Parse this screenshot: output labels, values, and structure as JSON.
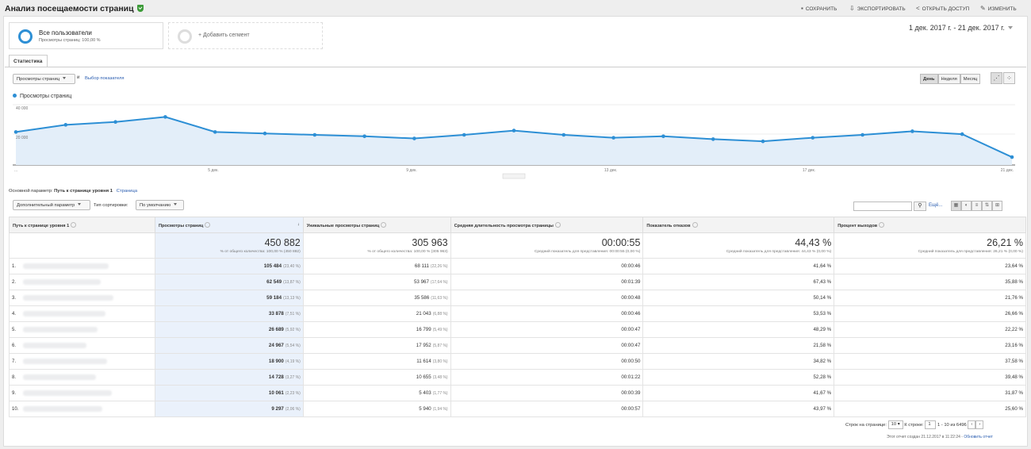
{
  "header": {
    "title": "Анализ посещаемости страниц",
    "actions": [
      "СОХРАНИТЬ",
      "ЭКСПОРТИРОВАТЬ",
      "ОТКРЫТЬ ДОСТУП",
      "ИЗМЕНИТЬ"
    ]
  },
  "segments": {
    "active_title": "Все пользователи",
    "active_sub": "Просмотры страниц: 100,00 %",
    "add_label": "+ Добавить сегмент"
  },
  "date_range": "1 дек. 2017 г. - 21 дек. 2017 г.",
  "tab": "Статистика",
  "metric_select": "Просмотры страниц",
  "and_label": "и",
  "choose_metric": "Выбор показателя",
  "granularity": [
    "День",
    "Неделя",
    "Месяц"
  ],
  "legend": "Просмотры страниц",
  "chart_data": {
    "type": "area",
    "x": [
      "1 дек.",
      "2 дек.",
      "3 дек.",
      "4 дек.",
      "5 дек.",
      "6 дек.",
      "7 дек.",
      "8 дек.",
      "9 дек.",
      "10 дек.",
      "11 дек.",
      "12 дек.",
      "13 дек.",
      "14 дек.",
      "15 дек.",
      "16 дек.",
      "17 дек.",
      "18 дек.",
      "19 дек.",
      "20 дек.",
      "21 дек."
    ],
    "x_tick_labels": [
      "...",
      "5 дек.",
      "9 дек.",
      "13 дек.",
      "17 дек.",
      "21 дек."
    ],
    "series": [
      {
        "name": "Просмотры страниц",
        "values": [
          23000,
          28000,
          30000,
          33500,
          23000,
          22000,
          21000,
          20000,
          18500,
          21000,
          24000,
          21000,
          19000,
          20000,
          18000,
          16500,
          19000,
          21000,
          23500,
          21500,
          5500
        ]
      }
    ],
    "y_tick_labels": [
      "20 000",
      "40 000"
    ],
    "ylim": [
      0,
      42000
    ],
    "color": "#2d8fd5"
  },
  "dimension": {
    "label": "Основной параметр:",
    "primary": "Путь к странице уровня 1",
    "alt": "Страница"
  },
  "controls": {
    "secondary": "Дополнительный параметр",
    "sort_label": "Тип сортировки:",
    "sort_value": "По умолчанию",
    "more": "Ещё..."
  },
  "table": {
    "columns": [
      "Путь к странице уровня 1",
      "Просмотры страниц",
      "Уникальные просмотры страниц",
      "Средняя длительность просмотра страницы",
      "Показатель отказов",
      "Процент выходов"
    ],
    "totals": [
      {
        "value": "450 882",
        "note": "% от общего количества: 100,00 % (450 882)"
      },
      {
        "value": "305 963",
        "note": "% от общего количества: 100,00 % (305 963)"
      },
      {
        "value": "00:00:55",
        "note": "Средний показатель для представления: 00:00:55 (0,00 %)"
      },
      {
        "value": "44,43 %",
        "note": "Средний показатель для представления: 44,43 % (0,00 %)"
      },
      {
        "value": "26,21 %",
        "note": "Средний показатель для представления: 26,21 % (0,00 %)"
      }
    ],
    "rows": [
      {
        "n": "1.",
        "pv": "105 484",
        "pvp": "(23,40 %)",
        "upv": "68 111",
        "upvp": "(22,26 %)",
        "dur": "00:00:46",
        "bounce": "41,64 %",
        "exit": "23,64 %"
      },
      {
        "n": "2.",
        "pv": "62 549",
        "pvp": "(13,87 %)",
        "upv": "53 967",
        "upvp": "(17,64 %)",
        "dur": "00:01:39",
        "bounce": "67,43 %",
        "exit": "35,88 %"
      },
      {
        "n": "3.",
        "pv": "59 184",
        "pvp": "(13,13 %)",
        "upv": "35 586",
        "upvp": "(11,63 %)",
        "dur": "00:00:48",
        "bounce": "50,14 %",
        "exit": "21,76 %"
      },
      {
        "n": "4.",
        "pv": "33 878",
        "pvp": "(7,51 %)",
        "upv": "21 043",
        "upvp": "(6,88 %)",
        "dur": "00:00:46",
        "bounce": "53,53 %",
        "exit": "26,66 %"
      },
      {
        "n": "5.",
        "pv": "26 689",
        "pvp": "(5,92 %)",
        "upv": "16 799",
        "upvp": "(5,49 %)",
        "dur": "00:00:47",
        "bounce": "48,29 %",
        "exit": "22,22 %"
      },
      {
        "n": "6.",
        "pv": "24 967",
        "pvp": "(5,54 %)",
        "upv": "17 952",
        "upvp": "(5,87 %)",
        "dur": "00:00:47",
        "bounce": "21,58 %",
        "exit": "23,16 %"
      },
      {
        "n": "7.",
        "pv": "18 900",
        "pvp": "(4,19 %)",
        "upv": "11 614",
        "upvp": "(3,80 %)",
        "dur": "00:00:50",
        "bounce": "34,82 %",
        "exit": "37,58 %"
      },
      {
        "n": "8.",
        "pv": "14 728",
        "pvp": "(3,27 %)",
        "upv": "10 655",
        "upvp": "(3,48 %)",
        "dur": "00:01:22",
        "bounce": "52,28 %",
        "exit": "39,48 %"
      },
      {
        "n": "9.",
        "pv": "10 061",
        "pvp": "(2,23 %)",
        "upv": "5 403",
        "upvp": "(1,77 %)",
        "dur": "00:00:39",
        "bounce": "41,67 %",
        "exit": "31,87 %"
      },
      {
        "n": "10.",
        "pv": "9 297",
        "pvp": "(2,06 %)",
        "upv": "5 940",
        "upvp": "(1,94 %)",
        "dur": "00:00:57",
        "bounce": "43,97 %",
        "exit": "25,60 %"
      }
    ]
  },
  "pager": {
    "rows_label": "Строк на странице:",
    "rows_value": "10",
    "goto_label": "К строке:",
    "goto_value": "1",
    "range": "1 - 10 из 6496"
  },
  "footer": {
    "note": "Этот отчет создан 21.12.2017 в 11:22:24 -",
    "refresh": "Обновить отчет"
  },
  "colors": {
    "accent": "#2d8fd5",
    "shield": "#3c9b38",
    "link": "#2a5db0"
  }
}
